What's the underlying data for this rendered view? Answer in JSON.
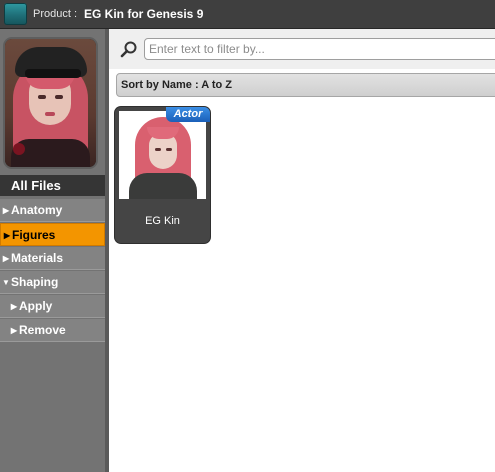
{
  "header": {
    "product_label": "Product :",
    "product_name": "EG Kin for Genesis 9"
  },
  "sidebar": {
    "category_header": "All Files",
    "items": [
      {
        "label": "Anatomy",
        "expanded": false
      },
      {
        "label": "Figures",
        "expanded": false,
        "selected": true
      },
      {
        "label": "Materials",
        "expanded": false
      },
      {
        "label": "Shaping",
        "expanded": true
      }
    ],
    "sub_items": [
      {
        "label": "Apply"
      },
      {
        "label": "Remove"
      }
    ]
  },
  "search": {
    "placeholder": "Enter text to filter by..."
  },
  "sort": {
    "label": "Sort by Name : A to Z"
  },
  "items": [
    {
      "label": "EG Kin",
      "badge": "Actor"
    }
  ],
  "icons": {
    "search": "search-icon",
    "product": "product-icon",
    "expand_arrow": "triangle-right-icon",
    "collapse_arrow": "triangle-down-icon"
  },
  "colors": {
    "selected": "#f39500",
    "badge": "#1a5fb8",
    "header_bg": "#3f3f3f",
    "sidebar_bg": "#737373"
  }
}
